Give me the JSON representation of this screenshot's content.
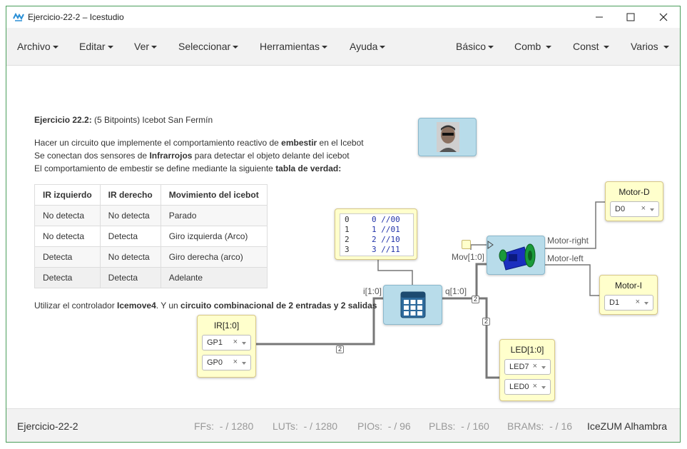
{
  "window": {
    "title": "Ejercicio-22-2 – Icestudio"
  },
  "menu_left": [
    {
      "label": "Archivo"
    },
    {
      "label": "Editar"
    },
    {
      "label": "Ver"
    },
    {
      "label": "Seleccionar"
    },
    {
      "label": "Herramientas"
    },
    {
      "label": "Ayuda"
    }
  ],
  "menu_right": [
    {
      "label": "Básico"
    },
    {
      "label": "Comb"
    },
    {
      "label": "Const"
    },
    {
      "label": "Varios"
    }
  ],
  "info": {
    "heading_bold": "Ejercicio 22.2:",
    "heading_rest": " (5 Bitpoints) Icebot San Fermín",
    "line1_a": "Hacer un circuito que implemente el comportamiento reactivo de ",
    "line1_b": "embestir",
    "line1_c": " en el Icebot",
    "line2_a": "Se conectan dos sensores de ",
    "line2_b": "Infrarrojos",
    "line2_c": " para detectar el objeto delante del icebot",
    "line3_a": "El comportamiento de embestir se define mediante la siguiente ",
    "line3_b": "tabla de verdad:",
    "footer_a": "Utilizar el controlador ",
    "footer_b": "Icemove4",
    "footer_c": ". Y un ",
    "footer_d": "circuito combinacional de 2 entradas y 2 salidas"
  },
  "truth_table": {
    "headers": [
      "IR izquierdo",
      "IR derecho",
      "Movimiento del icebot"
    ],
    "rows": [
      [
        "No detecta",
        "No detecta",
        "Parado"
      ],
      [
        "No detecta",
        "Detecta",
        "Giro izquierda (Arco)"
      ],
      [
        "Detecta",
        "No detecta",
        "Giro derecha (arco)"
      ],
      [
        "Detecta",
        "Detecta",
        "Adelante"
      ]
    ]
  },
  "blocks": {
    "ir": {
      "label": "IR[1:0]",
      "pins": [
        "GP1",
        "GP0"
      ]
    },
    "led": {
      "label": "LED[1:0]",
      "pins": [
        "LED7",
        "LED0"
      ]
    },
    "motor_d": {
      "label": "Motor-D",
      "pin": "D0"
    },
    "motor_i": {
      "label": "Motor-I",
      "pin": "D1"
    },
    "rom": {
      "lines": [
        {
          "n": "0",
          "code": "0 //00"
        },
        {
          "n": "1",
          "code": "1 //01"
        },
        {
          "n": "2",
          "code": "2 //10"
        },
        {
          "n": "3",
          "code": "3 //11"
        }
      ]
    },
    "table_block": {
      "in_label": "i[1:0]",
      "out_label": "q[1:0]"
    },
    "motor_ctrl": {
      "in_label": "Mov[1:0]",
      "out_right": "Motor-right",
      "out_left": "Motor-left"
    },
    "bus_width": "2",
    "clear_symbol": "×"
  },
  "status": {
    "project": "Ejercicio-22-2",
    "ffs_label": "FFs:",
    "ffs_value": "- / 1280",
    "luts_label": "LUTs:",
    "luts_value": "- / 1280",
    "pios_label": "PIOs:",
    "pios_value": "- / 96",
    "plbs_label": "PLBs:",
    "plbs_value": "- / 160",
    "brams_label": "BRAMs:",
    "brams_value": "- / 16",
    "board": "IceZUM Alhambra"
  }
}
